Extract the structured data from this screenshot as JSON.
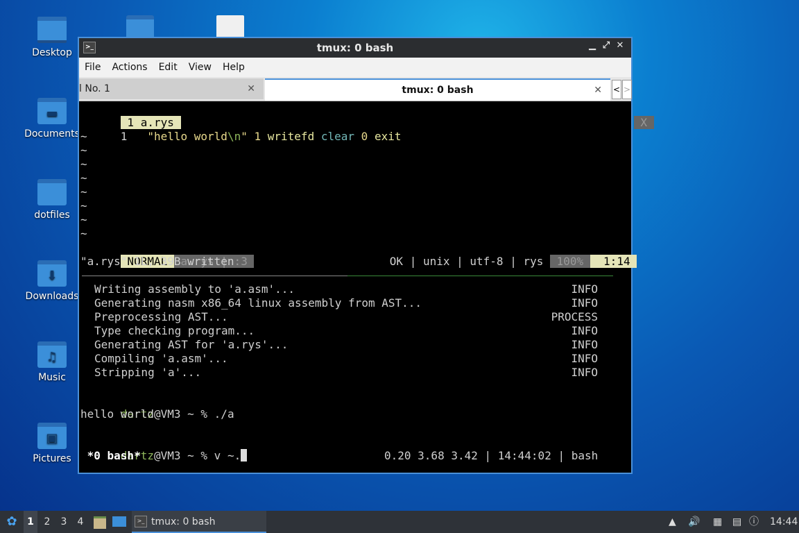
{
  "desktop": {
    "icons": [
      {
        "label": "Desktop",
        "icon": "monitor-icon"
      },
      {
        "label": "Documents",
        "icon": "document-folder-icon"
      },
      {
        "label": "dotfiles",
        "icon": "folder-icon"
      },
      {
        "label": "Downloads",
        "icon": "download-folder-icon"
      },
      {
        "label": "Music",
        "icon": "music-folder-icon"
      },
      {
        "label": "Pictures",
        "icon": "pictures-folder-icon"
      }
    ]
  },
  "window": {
    "title": "tmux: 0 bash",
    "menu": [
      "File",
      "Actions",
      "Edit",
      "View",
      "Help"
    ],
    "tabs": [
      {
        "label": "l No. 1"
      },
      {
        "label": "tmux: 0 bash"
      }
    ]
  },
  "vim": {
    "tabline": " 1 a.rys ",
    "close_label": " X ",
    "line_number": "1",
    "code": {
      "str": "\"hello world",
      "esc": "\\n",
      "str_end": "\"",
      "num1": "1",
      "word1": "writefd",
      "word2": "clear",
      "num2": "0",
      "word3": "exit"
    },
    "tildes": [
      "~",
      "~",
      "~",
      "~",
      "~",
      "~",
      "~",
      "~"
    ],
    "status_mode": " NORMAL ",
    "status_file": " a.rys | :3 ",
    "status_info": "OK | unix | utf-8 | rys ",
    "status_pct": " 100% ",
    "status_pos": "  1:14 ",
    "message": "\"a.rys\" 1L, 39B written"
  },
  "logs": [
    {
      "text": "Writing assembly to 'a.asm'...",
      "level": "INFO"
    },
    {
      "text": "Generating nasm x86_64 linux assembly from AST...",
      "level": "INFO"
    },
    {
      "text": "Preprocessing AST...",
      "level": "PROCESS"
    },
    {
      "text": "Type checking program...",
      "level": "INFO"
    },
    {
      "text": "Generating AST for 'a.rys'...",
      "level": "INFO"
    },
    {
      "text": "Compiling 'a.asm'...",
      "level": "INFO"
    },
    {
      "text": "Stripping 'a'...",
      "level": "INFO"
    }
  ],
  "shell": {
    "user": "dartz",
    "host_prompt": "@VM3 ~ % ",
    "cmd1": "./a",
    "output1": "hello world",
    "cmd2": "v ~."
  },
  "tmux_status": {
    "left": " *0 bash*",
    "right": "0.20 3.68 3.42 | 14:44:02 | bash "
  },
  "taskbar": {
    "workspaces": [
      "1",
      "2",
      "3",
      "4"
    ],
    "task_label": "tmux: 0 bash",
    "clock": "14:44"
  }
}
